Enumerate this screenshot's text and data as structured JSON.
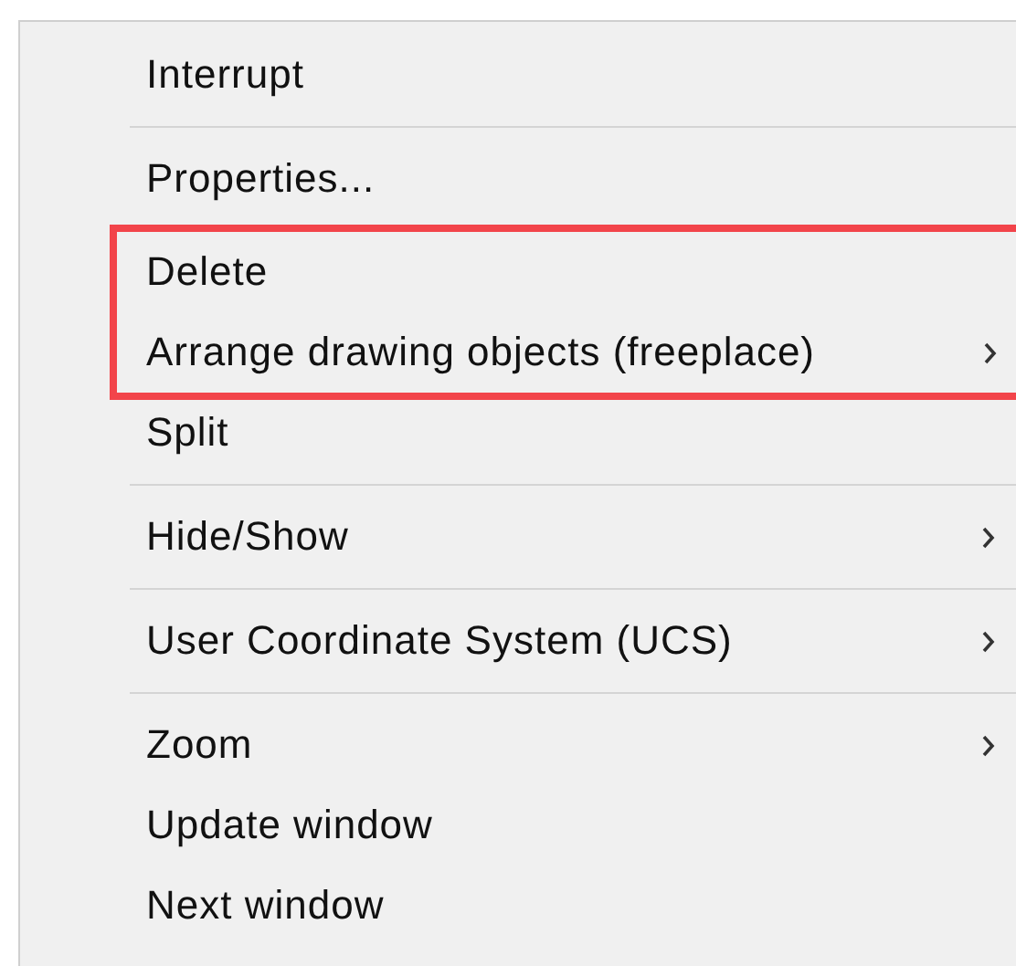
{
  "menu": {
    "sections": [
      {
        "blocks": [
          {
            "highlighted": false,
            "items": [
              {
                "label": "Interrupt",
                "submenu": false
              }
            ]
          }
        ]
      },
      {
        "blocks": [
          {
            "highlighted": false,
            "items": [
              {
                "label": "Properties...",
                "submenu": false
              }
            ]
          }
        ]
      },
      {
        "blocks": [
          {
            "highlighted": true,
            "items": [
              {
                "label": "Delete",
                "submenu": false
              },
              {
                "label": "Arrange drawing objects (freeplace)",
                "submenu": true
              }
            ]
          },
          {
            "highlighted": false,
            "items": [
              {
                "label": "Split",
                "submenu": false
              }
            ]
          }
        ]
      },
      {
        "blocks": [
          {
            "highlighted": false,
            "items": [
              {
                "label": "Hide/Show",
                "submenu": true
              }
            ]
          }
        ]
      },
      {
        "blocks": [
          {
            "highlighted": false,
            "items": [
              {
                "label": "User Coordinate System (UCS)",
                "submenu": true
              }
            ]
          }
        ]
      },
      {
        "blocks": [
          {
            "highlighted": false,
            "items": [
              {
                "label": "Zoom",
                "submenu": true
              },
              {
                "label": "Update window",
                "submenu": false
              },
              {
                "label": "Next window",
                "submenu": false
              }
            ]
          }
        ]
      }
    ]
  }
}
